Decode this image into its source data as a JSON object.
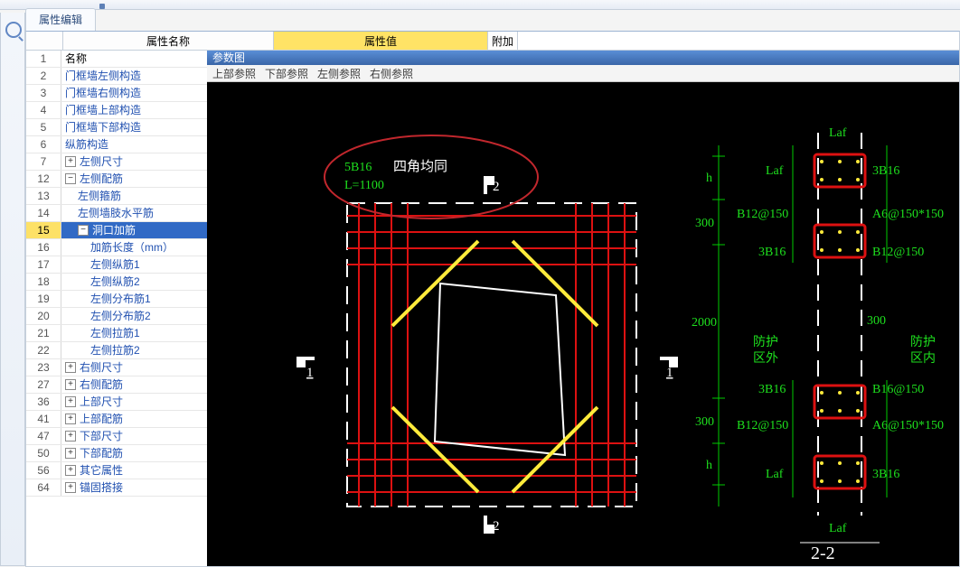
{
  "tabs": {
    "prop_edit": "属性编辑"
  },
  "grid": {
    "cols": {
      "name": "属性名称",
      "value": "属性值",
      "extra": "附加"
    },
    "rows": [
      {
        "n": "1",
        "t": "名称",
        "lvl": 0,
        "box": "",
        "blk": true
      },
      {
        "n": "2",
        "t": "门框墙左侧构造",
        "lvl": 0,
        "box": ""
      },
      {
        "n": "3",
        "t": "门框墙右侧构造",
        "lvl": 0,
        "box": ""
      },
      {
        "n": "4",
        "t": "门框墙上部构造",
        "lvl": 0,
        "box": ""
      },
      {
        "n": "5",
        "t": "门框墙下部构造",
        "lvl": 0,
        "box": ""
      },
      {
        "n": "6",
        "t": "纵筋构造",
        "lvl": 0,
        "box": ""
      },
      {
        "n": "7",
        "t": "左侧尺寸",
        "lvl": 0,
        "box": "+"
      },
      {
        "n": "12",
        "t": "左侧配筋",
        "lvl": 0,
        "box": "-"
      },
      {
        "n": "13",
        "t": "左侧箍筋",
        "lvl": 1,
        "box": ""
      },
      {
        "n": "14",
        "t": "左侧墙肢水平筋",
        "lvl": 1,
        "box": ""
      },
      {
        "n": "15",
        "t": "洞口加筋",
        "lvl": 1,
        "box": "-",
        "sel": true
      },
      {
        "n": "16",
        "t": "加筋长度（mm）",
        "lvl": 2,
        "box": ""
      },
      {
        "n": "17",
        "t": "左侧纵筋1",
        "lvl": 2,
        "box": ""
      },
      {
        "n": "18",
        "t": "左侧纵筋2",
        "lvl": 2,
        "box": ""
      },
      {
        "n": "19",
        "t": "左侧分布筋1",
        "lvl": 2,
        "box": ""
      },
      {
        "n": "20",
        "t": "左侧分布筋2",
        "lvl": 2,
        "box": ""
      },
      {
        "n": "21",
        "t": "左侧拉筋1",
        "lvl": 2,
        "box": ""
      },
      {
        "n": "22",
        "t": "左侧拉筋2",
        "lvl": 2,
        "box": ""
      },
      {
        "n": "23",
        "t": "右侧尺寸",
        "lvl": 0,
        "box": "+"
      },
      {
        "n": "27",
        "t": "右侧配筋",
        "lvl": 0,
        "box": "+"
      },
      {
        "n": "36",
        "t": "上部尺寸",
        "lvl": 0,
        "box": "+"
      },
      {
        "n": "41",
        "t": "上部配筋",
        "lvl": 0,
        "box": "+"
      },
      {
        "n": "47",
        "t": "下部尺寸",
        "lvl": 0,
        "box": "+"
      },
      {
        "n": "50",
        "t": "下部配筋",
        "lvl": 0,
        "box": "+"
      },
      {
        "n": "56",
        "t": "其它属性",
        "lvl": 0,
        "box": "+"
      },
      {
        "n": "64",
        "t": "锚固搭接",
        "lvl": 0,
        "box": "+"
      }
    ]
  },
  "viewport": {
    "title": "参数图",
    "menu": [
      "上部参照",
      "下部参照",
      "左侧参照",
      "右侧参照"
    ],
    "left": {
      "spec": "5B16",
      "corners": "四角均同",
      "L": "1100"
    },
    "dims": {
      "h": "h",
      "d1": "300",
      "mid": "2000",
      "d2": "300"
    },
    "sec": {
      "laf": "Laf",
      "l1": "B12@150",
      "l2": "3B16",
      "r1": "3B16",
      "r2": "A6@150*150",
      "r3": "B12@150",
      "r4": "B16@150",
      "zone_out1": "防护",
      "zone_out2": "区外",
      "zone_in1": "防护",
      "zone_in2": "区内",
      "title": "2-2"
    }
  }
}
